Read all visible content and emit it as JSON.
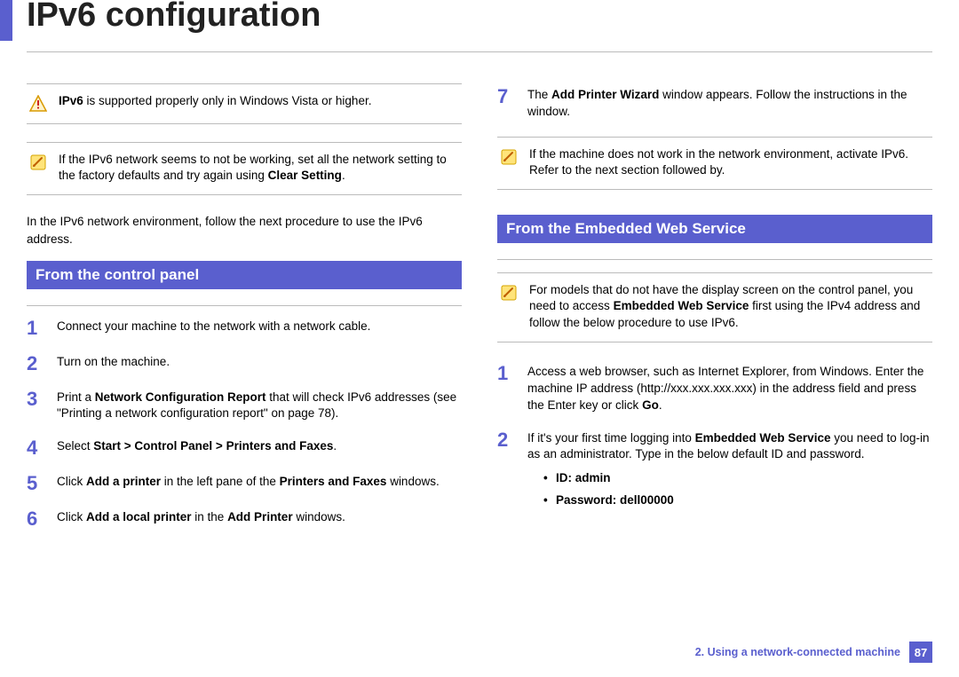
{
  "title": "IPv6 configuration",
  "left": {
    "note_warning_pre": "",
    "note_warning_bold": "IPv6",
    "note_warning_post": " is supported properly only in Windows Vista or higher.",
    "note_tip_pre": "If the IPv6 network seems to not be working, set all the network setting to the factory defaults and try again using ",
    "note_tip_bold": "Clear Setting",
    "note_tip_post": ".",
    "intro": "In the IPv6 network environment, follow the next procedure to use the IPv6 address.",
    "section": "From the control panel",
    "steps": {
      "s1": "Connect your machine to the network with a network cable.",
      "s2": "Turn on the machine.",
      "s3_pre": "Print a ",
      "s3_b": "Network Configuration Report",
      "s3_post": " that will check IPv6 addresses (see \"Printing a network configuration report\" on page 78).",
      "s4_pre": "Select ",
      "s4_b": "Start > Control Panel > Printers and Faxes",
      "s4_post": ".",
      "s5_pre": "Click ",
      "s5_b1": "Add a printer",
      "s5_mid": " in the left pane of the ",
      "s5_b2": "Printers and Faxes",
      "s5_post": " windows.",
      "s6_pre": "Click ",
      "s6_b1": "Add a local printer",
      "s6_mid": " in the ",
      "s6_b2": "Add Printer",
      "s6_post": " windows."
    }
  },
  "right": {
    "step7_pre": "The ",
    "step7_b": "Add Printer Wizard",
    "step7_post": " window appears. Follow the instructions in the window.",
    "note_tip": "If the machine does not work in the network environment, activate IPv6. Refer to the next section followed by.",
    "section": "From the Embedded Web Service",
    "note2_pre": "For models that do not have the display screen on the control panel, you need to access ",
    "note2_b": "Embedded Web Service",
    "note2_post": " first using the IPv4 address and follow the below procedure to use IPv6.",
    "steps": {
      "s1_pre": "Access a web browser, such as Internet Explorer, from Windows. Enter the machine IP address (http://xxx.xxx.xxx.xxx) in the address field and press the Enter key or click ",
      "s1_b": "Go",
      "s1_post": ".",
      "s2_pre": "If it's your first time logging into ",
      "s2_b": "Embedded Web Service",
      "s2_post": " you need to log-in as an administrator. Type in the below default ID and password.",
      "bullet_id": "ID: admin",
      "bullet_pw": "Password: dell00000"
    }
  },
  "footer": {
    "chapter": "2.  Using a network-connected machine",
    "page": "87"
  }
}
